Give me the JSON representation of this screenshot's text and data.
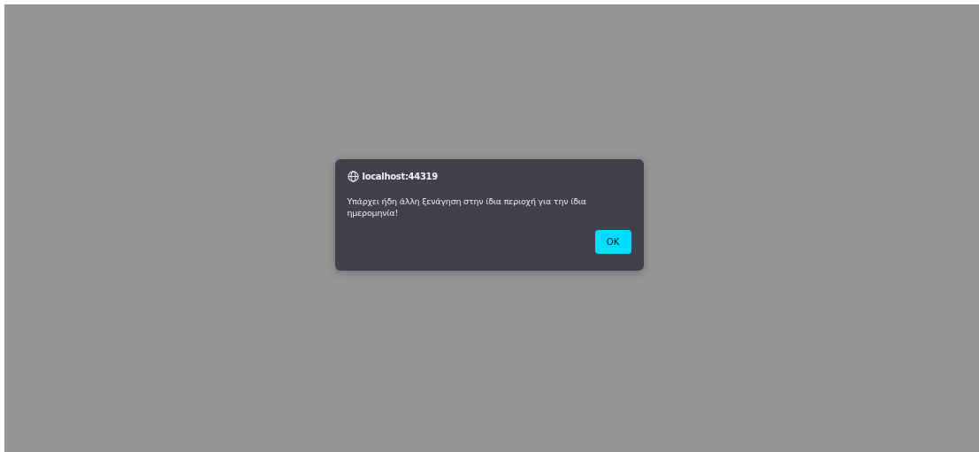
{
  "dialog": {
    "origin": "localhost:44319",
    "message": "Υπάρχει ήδη άλλη ξενάγηση στην ίδια περιοχή για την ίδια ημερομηνία!",
    "buttons": [
      {
        "label": "OK"
      }
    ]
  }
}
